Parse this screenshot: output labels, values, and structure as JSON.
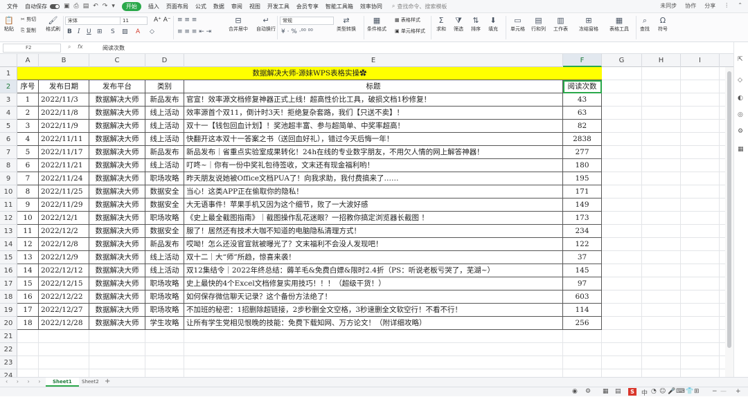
{
  "menubar": {
    "file": "文件",
    "autosave": "自动保存",
    "start": "开始",
    "tabs": [
      "插入",
      "页面布局",
      "公式",
      "数据",
      "审阅",
      "视图",
      "开发工具",
      "会员专享",
      "智能工具箱",
      "效率协同"
    ],
    "search": "查找命令、搜索模板",
    "right_items": [
      "未同步",
      "协作",
      "分享"
    ]
  },
  "ribbon": {
    "paste": "粘贴",
    "cut": "剪切",
    "copy": "复制",
    "format_painter": "格式刷",
    "font": "宋体",
    "size": "11",
    "merge": "合并居中",
    "wrap": "自动换行",
    "number_format": "常规",
    "type_convert": "类型转换",
    "cond_format": "条件格式",
    "table_style": "表格样式",
    "cell_style": "单元格样式",
    "sum": "求和",
    "filter": "筛选",
    "sort": "排序",
    "fill": "填充",
    "cell": "单元格",
    "rowcol": "行和列",
    "worksheet": "工作表",
    "freeze": "冻结窗格",
    "table_tools": "表格工具",
    "find": "查找",
    "symbol": "符号"
  },
  "formula_bar": {
    "name_box": "F2",
    "fx": "fx",
    "content": "阅读次数"
  },
  "columns": [
    "A",
    "B",
    "C",
    "D",
    "E",
    "F",
    "G",
    "H",
    "I"
  ],
  "rows": [
    "1",
    "2",
    "3",
    "4",
    "5",
    "6",
    "7",
    "8",
    "9",
    "10",
    "11",
    "12",
    "13",
    "14",
    "15",
    "16",
    "17",
    "18",
    "19",
    "20",
    "21",
    "22",
    "23",
    "24"
  ],
  "sheet_title": "数据解决大师-源妹WPS表格实操✿",
  "headers": [
    "序号",
    "发布日期",
    "发布平台",
    "类别",
    "标题",
    "阅读次数"
  ],
  "data": [
    [
      "1",
      "2022/11/3",
      "数据解决大师",
      "新品发布",
      "官宣！效率源文档修复神器正式上线！超高性价比工具，破损文档1秒修复！",
      "43"
    ],
    [
      "2",
      "2022/11/8",
      "数据解决大师",
      "线上活动",
      "效率源首个双11，倒计时3天！拒绝复杂套路，我们【只送不卖】！",
      "63"
    ],
    [
      "3",
      "2022/11/9",
      "数据解决大师",
      "线上活动",
      "双十一【钱包回血计划】！奖池超丰富、参与超简单、中奖率超高！",
      "82"
    ],
    [
      "4",
      "2022/11/11",
      "数据解决大师",
      "线上活动",
      "快翻开这本双十一答案之书（送回血好礼），错过今天后悔一年！",
      "2838"
    ],
    [
      "5",
      "2022/11/17",
      "数据解决大师",
      "新品发布",
      "新品发布｜省重点实验室成果转化！24h在线的专业数字朋友，不用欠人情的网上解答神器！",
      "277"
    ],
    [
      "6",
      "2022/11/21",
      "数据解决大师",
      "线上活动",
      "叮咚~｜你有一份中奖礼包待签收，文末还有现金福利哟！",
      "180"
    ],
    [
      "7",
      "2022/11/24",
      "数据解决大师",
      "职场攻略",
      "昨天朋友说她被Office文档PUA了！向我求助，我付费搞来了……",
      "195"
    ],
    [
      "8",
      "2022/11/25",
      "数据解决大师",
      "数据安全",
      "当心！这类APP正在偷取你的隐私！",
      "171"
    ],
    [
      "9",
      "2022/11/29",
      "数据解决大师",
      "数据安全",
      "大无语事件！苹果手机又因为这个细节，败了一大波好感",
      "149"
    ],
    [
      "10",
      "2022/12/1",
      "数据解决大师",
      "职场攻略",
      "《史上最全截图指南》｜截图操作乱花迷眼？一招教你搞定浏览器长截图 ！",
      "173"
    ],
    [
      "11",
      "2022/12/2",
      "数据解决大师",
      "数据安全",
      "服了！居然还有技术大咖不知道的电脑隐私清理方式！",
      "234"
    ],
    [
      "12",
      "2022/12/8",
      "数据解决大师",
      "新品发布",
      "哎呦！怎么还没官宣就被曝光了？文末福利不会没人发现吧！",
      "122"
    ],
    [
      "13",
      "2022/12/9",
      "数据解决大师",
      "线上活动",
      "双十二｜大“师”所趋，惊喜来袭！",
      "37"
    ],
    [
      "14",
      "2022/12/12",
      "数据解决大师",
      "线上活动",
      "双12集结令｜2022年终总结：薅羊毛&免费白嫖&限时2.4折（PS：听说老板亏哭了，芜湖~）",
      "145"
    ],
    [
      "15",
      "2022/12/15",
      "数据解决大师",
      "职场攻略",
      "史上最快的4个Excel文档修复实用技巧！！！（超级干货！）",
      "97"
    ],
    [
      "16",
      "2022/12/22",
      "数据解决大师",
      "职场攻略",
      "如何保存微信聊天记录？这个备份方法绝了！",
      "603"
    ],
    [
      "17",
      "2022/12/27",
      "数据解决大师",
      "职场攻略",
      "不加班的秘密：1招删除超链接，2步秒删全文空格，3秒速删全文软空行！不看不行！",
      "114"
    ],
    [
      "18",
      "2022/12/28",
      "数据解决大师",
      "学生攻略",
      "让所有学生党相见恨晚的技能：免费下载知网、万方论文！（附详细攻略）",
      "256"
    ]
  ],
  "sheet_tabs": [
    "Sheet1",
    "Sheet2"
  ],
  "status": {
    "ime": "中",
    "zoom_minus": "−",
    "zoom_plus": "+"
  }
}
